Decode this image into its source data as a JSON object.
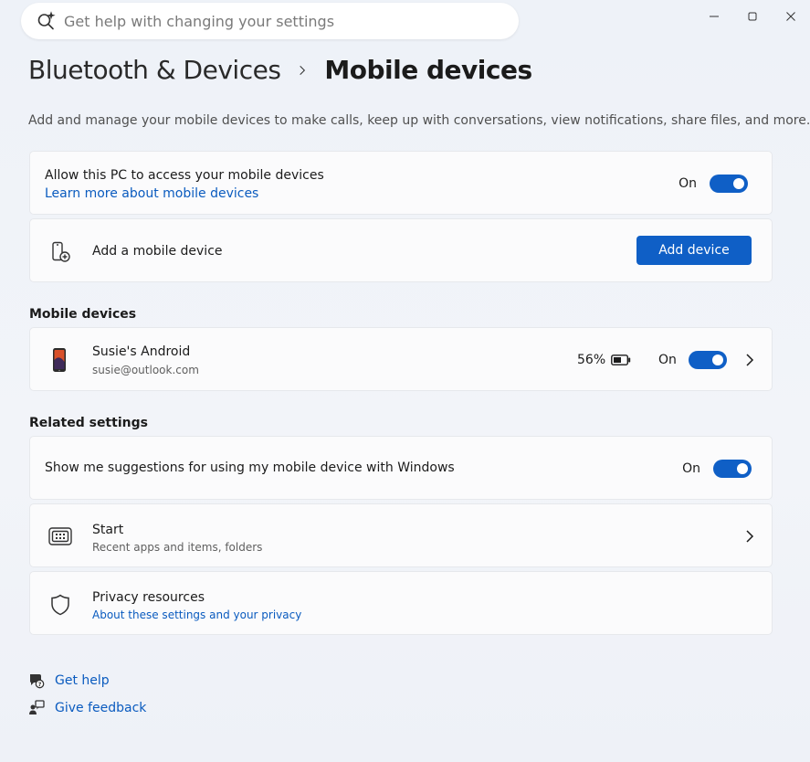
{
  "search": {
    "placeholder": "Get help with changing your settings"
  },
  "header": {
    "parent": "Bluetooth & Devices",
    "current": "Mobile devices",
    "description": "Add and manage your mobile devices to make calls, keep up with conversations, view notifications, share files, and more."
  },
  "access": {
    "title": "Allow this PC to access your mobile devices",
    "link": "Learn more about mobile devices",
    "state": "On"
  },
  "add_device": {
    "title": "Add a mobile device",
    "button": "Add device"
  },
  "mobile_devices": {
    "header": "Mobile devices",
    "device": {
      "name": "Susie's Android",
      "email": "susie@outlook.com",
      "battery": "56%",
      "state": "On"
    }
  },
  "related": {
    "header": "Related settings",
    "suggestions": {
      "title": "Show me suggestions for using my mobile device with Windows",
      "state": "On"
    },
    "start": {
      "title": "Start",
      "sub": "Recent apps and items, folders"
    },
    "privacy": {
      "title": "Privacy resources",
      "link": "About these settings and your privacy"
    }
  },
  "footer": {
    "help": "Get help",
    "feedback": "Give feedback"
  },
  "colors": {
    "accent": "#0f5fc6",
    "link": "#0a5bbf"
  }
}
